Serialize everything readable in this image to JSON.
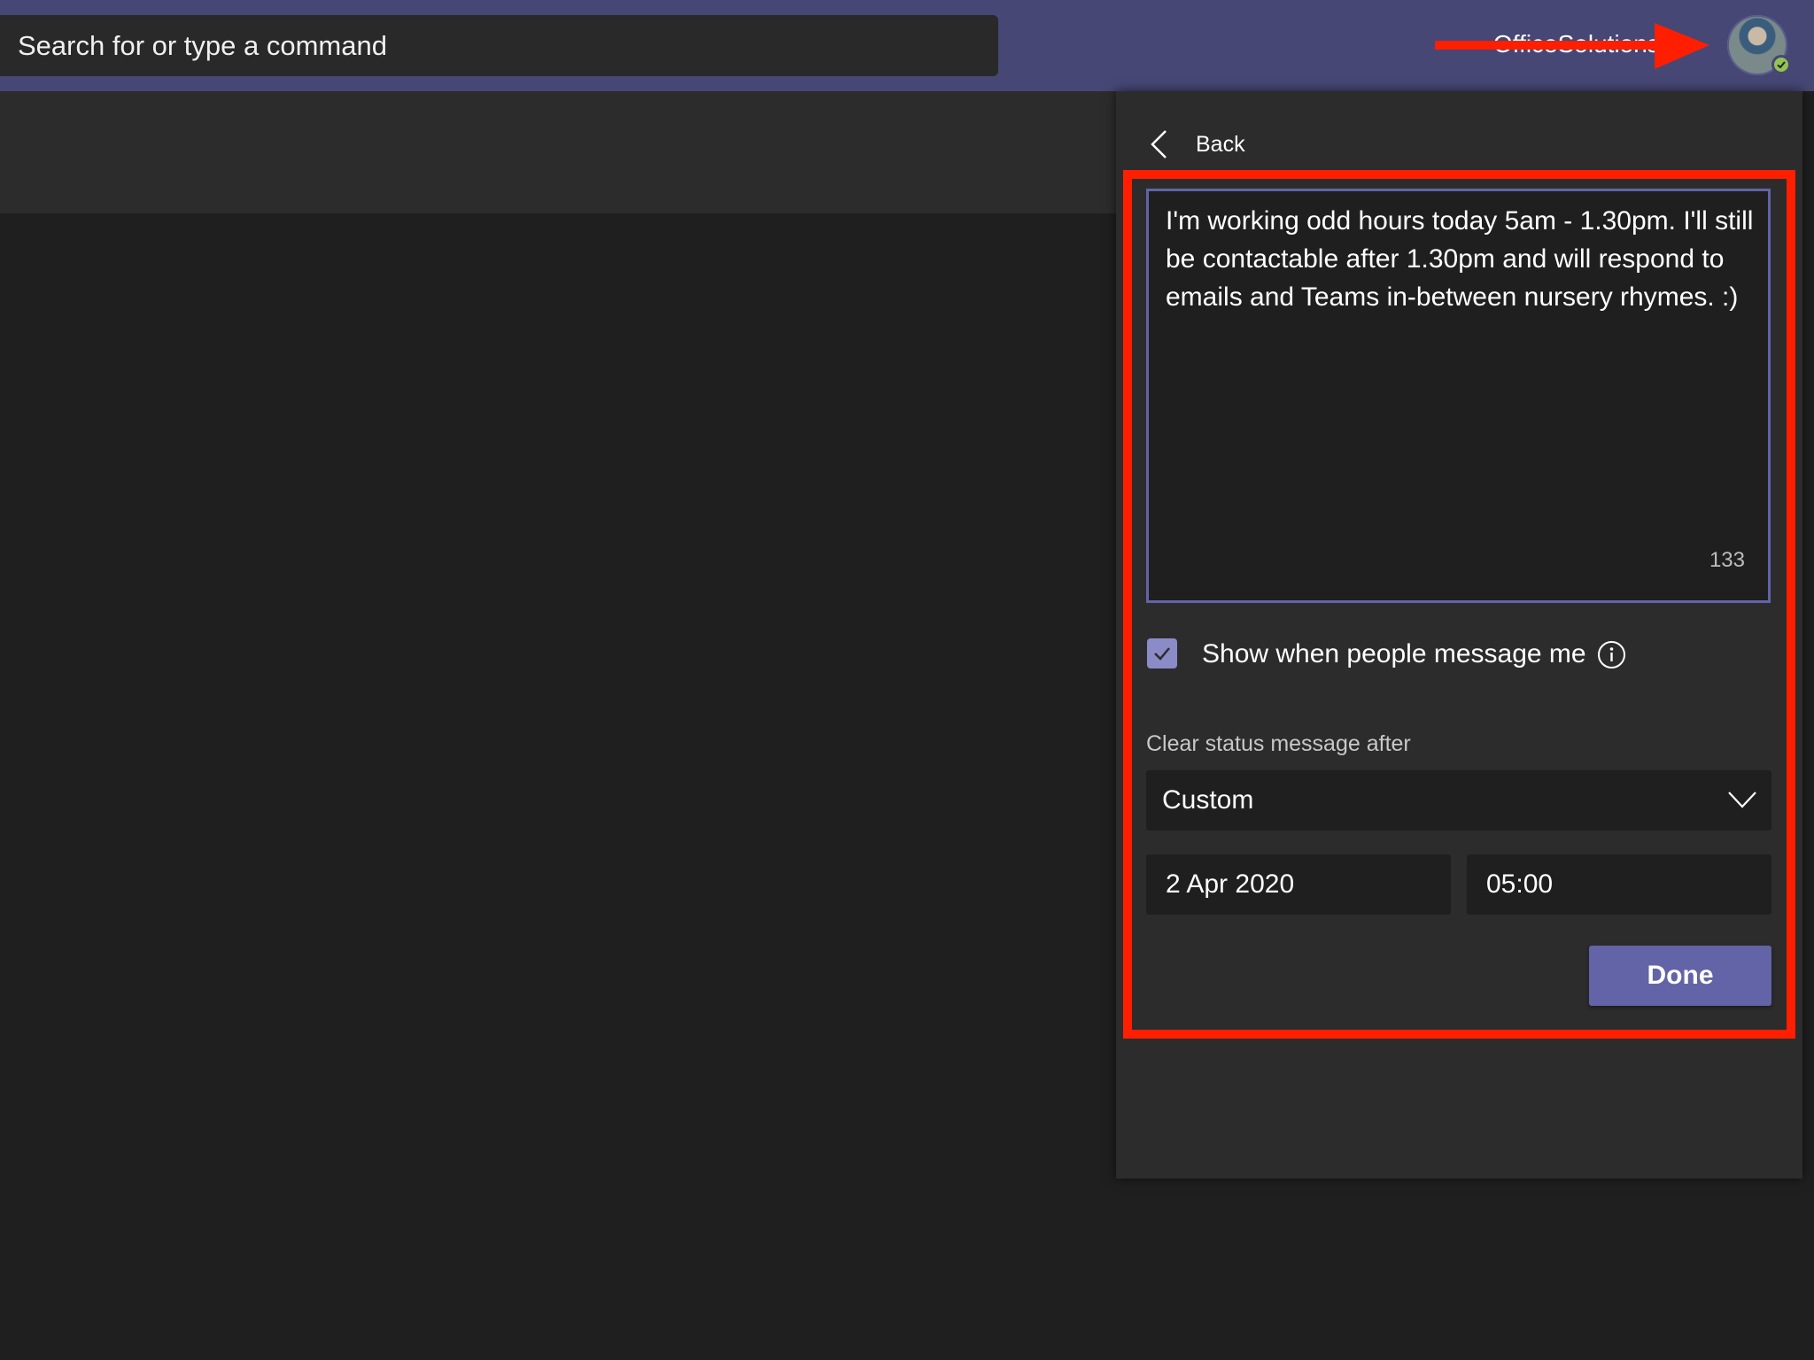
{
  "header": {
    "search_placeholder": "Search for or type a command",
    "username": "OfficeSolutionsIT",
    "presence_status": "available",
    "presence_color": "#92c353",
    "accent_color": "#464775"
  },
  "status_panel": {
    "back_label": "Back",
    "status_message": "I'm working odd hours today 5am - 1.30pm. I'll still be contactable after 1.30pm and will respond to emails and Teams in-between nursery rhymes. :)",
    "char_count": "133",
    "show_when_messaged_label": "Show when people message me",
    "show_when_messaged_checked": true,
    "clear_after_label": "Clear status message after",
    "clear_after_value": "Custom",
    "clear_date": "2 Apr 2020",
    "clear_time": "05:00",
    "done_label": "Done",
    "button_color": "#6264a7"
  },
  "annotations": {
    "highlight_color": "#ff1f00"
  }
}
